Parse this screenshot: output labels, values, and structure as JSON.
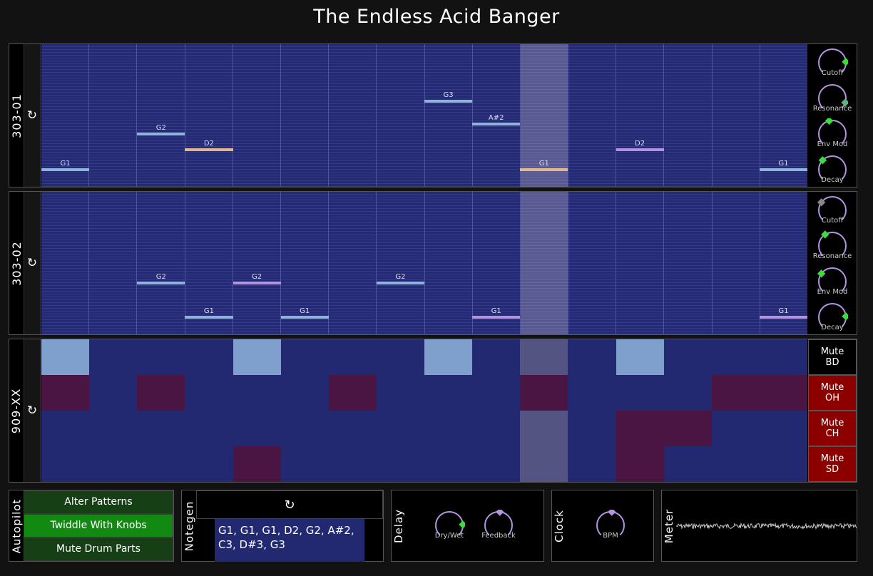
{
  "title": "The Endless Acid Banger",
  "synths": [
    {
      "name": "303-01",
      "loop_icon": "↻",
      "active_step": 11,
      "notes": [
        {
          "step": 1,
          "pitch": "G1",
          "height": 0.13,
          "color": "#8fb3dd"
        },
        {
          "step": 3,
          "pitch": "G2",
          "height": 0.38,
          "color": "#8fb3dd"
        },
        {
          "step": 4,
          "pitch": "D2",
          "height": 0.27,
          "color": "#e3b88f"
        },
        {
          "step": 9,
          "pitch": "G3",
          "height": 0.61,
          "color": "#8fb3dd"
        },
        {
          "step": 10,
          "pitch": "A#2",
          "height": 0.45,
          "color": "#8fb3dd"
        },
        {
          "step": 11,
          "pitch": "G1",
          "height": 0.13,
          "color": "#e3b88f"
        },
        {
          "step": 13,
          "pitch": "D2",
          "height": 0.27,
          "color": "#b493e0"
        },
        {
          "step": 16,
          "pitch": "G1",
          "height": 0.13,
          "color": "#8fb3dd"
        }
      ],
      "knobs": [
        {
          "label": "Cutoff",
          "value": 0.82,
          "color": "#3ddc3d"
        },
        {
          "label": "Resonance",
          "value": 0.9,
          "color": "#60b080"
        },
        {
          "label": "Env Mod",
          "value": 0.45,
          "color": "#3ddc3d"
        },
        {
          "label": "Decay",
          "value": 0.33,
          "color": "#3ddc3d"
        }
      ]
    },
    {
      "name": "303-02",
      "loop_icon": "↻",
      "active_step": 11,
      "notes": [
        {
          "step": 3,
          "pitch": "G2",
          "height": 0.37,
          "color": "#8fb3dd"
        },
        {
          "step": 4,
          "pitch": "G1",
          "height": 0.13,
          "color": "#8fb3dd"
        },
        {
          "step": 5,
          "pitch": "G2",
          "height": 0.37,
          "color": "#b493e0"
        },
        {
          "step": 6,
          "pitch": "G1",
          "height": 0.13,
          "color": "#8fb3dd"
        },
        {
          "step": 8,
          "pitch": "G2",
          "height": 0.37,
          "color": "#8fb3dd"
        },
        {
          "step": 10,
          "pitch": "G1",
          "height": 0.13,
          "color": "#b493e0"
        },
        {
          "step": 16,
          "pitch": "G1",
          "height": 0.13,
          "color": "#b493e0"
        }
      ],
      "knobs": [
        {
          "label": "Cutoff",
          "value": 0.3,
          "color": "#888888"
        },
        {
          "label": "Resonance",
          "value": 0.38,
          "color": "#3ddc3d"
        },
        {
          "label": "Env Mod",
          "value": 0.3,
          "color": "#3ddc3d"
        },
        {
          "label": "Decay",
          "value": 0.82,
          "color": "#3ddc3d"
        }
      ]
    }
  ],
  "drums": {
    "name": "909-XX",
    "loop_icon": "↻",
    "active_step": 11,
    "rows": [
      {
        "id": "BD",
        "mute_label": "Mute BD",
        "muted": false,
        "on_color": "#7fa0cc",
        "steps": [
          1,
          0,
          0,
          0,
          1,
          0,
          0,
          0,
          1,
          0,
          0,
          0,
          1,
          0,
          0,
          0
        ]
      },
      {
        "id": "OH",
        "mute_label": "Mute OH",
        "muted": true,
        "on_color": "#4a1542",
        "steps": [
          1,
          0,
          1,
          0,
          0,
          0,
          1,
          0,
          0,
          0,
          1,
          0,
          0,
          0,
          1,
          1
        ]
      },
      {
        "id": "CH",
        "mute_label": "Mute CH",
        "muted": true,
        "on_color": "#4a1542",
        "steps": [
          0,
          0,
          0,
          0,
          0,
          0,
          0,
          0,
          0,
          0,
          0,
          0,
          1,
          1,
          0,
          0
        ]
      },
      {
        "id": "SD",
        "mute_label": "Mute SD",
        "muted": true,
        "on_color": "#4a1542",
        "steps": [
          0,
          0,
          0,
          0,
          1,
          0,
          0,
          0,
          0,
          0,
          0,
          0,
          1,
          0,
          0,
          0
        ]
      }
    ]
  },
  "autopilot": {
    "label": "Autopilot",
    "buttons": [
      {
        "label": "Alter Patterns",
        "active": false
      },
      {
        "label": "Twiddle With Knobs",
        "active": true
      },
      {
        "label": "Mute Drum Parts",
        "active": false
      }
    ]
  },
  "notegen": {
    "label": "Notegen",
    "refresh_icon": "↻",
    "notes_text": "G1, G1, G1, D2, G2, A#2, C3, D#3, G3"
  },
  "delay": {
    "label": "Delay",
    "knobs": [
      {
        "label": "Dry/Wet",
        "value": 0.82,
        "color": "#3ddc3d"
      },
      {
        "label": "Feedback",
        "value": 0.52,
        "color": "#b493e0"
      }
    ]
  },
  "clock": {
    "label": "Clock",
    "knobs": [
      {
        "label": "BPM",
        "value": 0.52,
        "color": "#b493e0"
      }
    ]
  },
  "meter": {
    "label": "Meter"
  },
  "colors": {
    "accent": "#b493e0",
    "knob_green": "#3ddc3d",
    "mute_on": "#8c0000",
    "autopilot_active": "#128a12",
    "autopilot_inactive": "#163f16"
  }
}
